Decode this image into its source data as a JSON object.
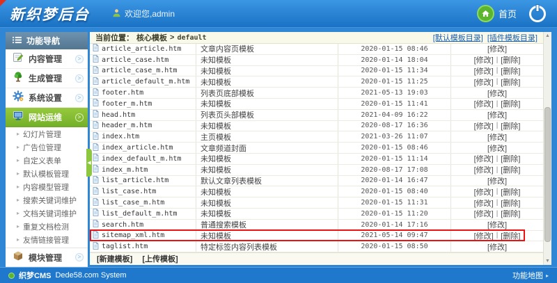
{
  "header": {
    "logo": "新织梦后台",
    "welcome": "欢迎您,admin",
    "home": "首页"
  },
  "sidebar": {
    "title": "功能导航",
    "items": [
      {
        "label": "内容管理",
        "icon": "edit-icon",
        "active": false
      },
      {
        "label": "生成管理",
        "icon": "tree-icon",
        "active": false
      },
      {
        "label": "系统设置",
        "icon": "gear-icon",
        "active": false
      },
      {
        "label": "网站运维",
        "icon": "monitor-icon",
        "active": true
      }
    ],
    "subitems": [
      "幻灯片管理",
      "广告位管理",
      "自定义表单",
      "默认模板管理",
      "内容模型管理",
      "搜索关键词维护",
      "文档关键词维护",
      "重复文档检测",
      "友情链接管理"
    ],
    "module": {
      "label": "模块管理",
      "icon": "module-icon"
    }
  },
  "main": {
    "breadcrumb": {
      "label": "当前位置：",
      "section": "核心模板",
      "separator": ">",
      "current": "default"
    },
    "dir_links": [
      "[默认模板目录]",
      "[插件模板目录]"
    ],
    "actions_separator": "|",
    "rows": [
      {
        "file": "article_article.htm",
        "desc": "文章内容页模板",
        "date": "2020-01-15 08:46",
        "actions": [
          "[修改]"
        ],
        "highlight": false
      },
      {
        "file": "article_case.htm",
        "desc": "未知模板",
        "date": "2020-01-14 18:04",
        "actions": [
          "[修改]",
          "[删除]"
        ],
        "highlight": false
      },
      {
        "file": "article_case_m.htm",
        "desc": "未知模板",
        "date": "2020-01-15 11:34",
        "actions": [
          "[修改]",
          "[删除]"
        ],
        "highlight": false
      },
      {
        "file": "article_default_m.htm",
        "desc": "未知模板",
        "date": "2020-01-15 11:25",
        "actions": [
          "[修改]",
          "[删除]"
        ],
        "highlight": false
      },
      {
        "file": "footer.htm",
        "desc": "列表页底部模板",
        "date": "2021-05-13 19:03",
        "actions": [
          "[修改]"
        ],
        "highlight": false
      },
      {
        "file": "footer_m.htm",
        "desc": "未知模板",
        "date": "2020-01-15 11:41",
        "actions": [
          "[修改]",
          "[删除]"
        ],
        "highlight": false
      },
      {
        "file": "head.htm",
        "desc": "列表页头部模板",
        "date": "2021-04-09 16:22",
        "actions": [
          "[修改]"
        ],
        "highlight": false
      },
      {
        "file": "header_m.htm",
        "desc": "未知模板",
        "date": "2020-08-17 16:36",
        "actions": [
          "[修改]",
          "[删除]"
        ],
        "highlight": false
      },
      {
        "file": "index.htm",
        "desc": "主页模板",
        "date": "2021-03-26 11:07",
        "actions": [
          "[修改]"
        ],
        "highlight": false
      },
      {
        "file": "index_article.htm",
        "desc": "文章频道封面",
        "date": "2020-01-15 08:46",
        "actions": [
          "[修改]"
        ],
        "highlight": false
      },
      {
        "file": "index_default_m.htm",
        "desc": "未知模板",
        "date": "2020-01-15 11:14",
        "actions": [
          "[修改]",
          "[删除]"
        ],
        "highlight": false
      },
      {
        "file": "index_m.htm",
        "desc": "未知模板",
        "date": "2020-08-17 17:08",
        "actions": [
          "[修改]",
          "[删除]"
        ],
        "highlight": false
      },
      {
        "file": "list_article.htm",
        "desc": "默认文章列表模板",
        "date": "2020-01-14 16:47",
        "actions": [
          "[修改]"
        ],
        "highlight": false
      },
      {
        "file": "list_case.htm",
        "desc": "未知模板",
        "date": "2020-01-15 08:40",
        "actions": [
          "[修改]",
          "[删除]"
        ],
        "highlight": false
      },
      {
        "file": "list_case_m.htm",
        "desc": "未知模板",
        "date": "2020-01-15 11:31",
        "actions": [
          "[修改]",
          "[删除]"
        ],
        "highlight": false
      },
      {
        "file": "list_default_m.htm",
        "desc": "未知模板",
        "date": "2020-01-15 11:20",
        "actions": [
          "[修改]",
          "[删除]"
        ],
        "highlight": false
      },
      {
        "file": "search.htm",
        "desc": "普通搜索模板",
        "date": "2020-01-14 17:16",
        "actions": [
          "[修改]"
        ],
        "highlight": false
      },
      {
        "file": "sitemap_xml.htm",
        "desc": "未知模板",
        "date": "2021-05-14 09:47",
        "actions": [
          "[修改]",
          "[删除]"
        ],
        "highlight": true
      },
      {
        "file": "taglist.htm",
        "desc": "特定标签内容列表模板",
        "date": "2020-01-15 08:50",
        "actions": [
          "[修改]"
        ],
        "highlight": false
      }
    ],
    "bottom_buttons": [
      "[新建模板]",
      "[上传模板]"
    ]
  },
  "footer": {
    "brand": "织梦CMS",
    "system": "Dede58.com System",
    "right": "功能地图"
  },
  "colors": {
    "accent_green": "#8dc63f",
    "header_blue": "#2482d8",
    "highlight_red": "#ee1111"
  }
}
